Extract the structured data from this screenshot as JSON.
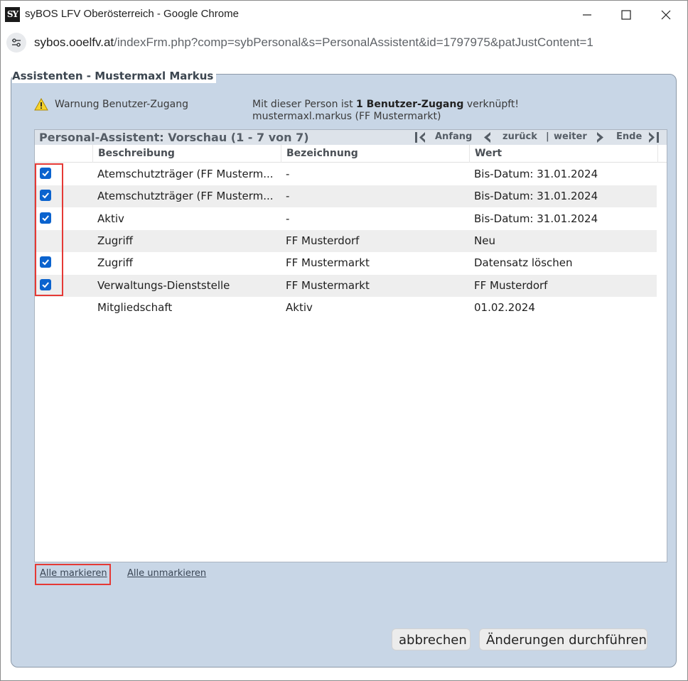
{
  "window": {
    "logo": "SY",
    "title": "syBOS LFV Oberösterreich - Google Chrome"
  },
  "address": {
    "host": "sybos.ooelfv.at",
    "path": "/indexFrm.php?comp=sybPersonal&s=PersonalAssistent&id=1797975&patJustContent=1"
  },
  "panel": {
    "title": "Assistenten - Mustermaxl Markus"
  },
  "warning": {
    "label": "Warnung Benutzer-Zugang",
    "line1_pre": "Mit dieser Person ist ",
    "line1_bold": "1 Benutzer-Zugang",
    "line1_post": " verknüpft!",
    "line2": "mustermaxl.markus (FF Mustermarkt)"
  },
  "grid": {
    "title": "Personal-Assistent: Vorschau (1 - 7 von 7)",
    "pager": {
      "first": "Anfang",
      "prev": "zurück",
      "separator": "|",
      "next": "weiter",
      "last": "Ende"
    },
    "columns": [
      "Beschreibung",
      "Bezeichnung",
      "Wert"
    ],
    "rows": [
      {
        "checked": true,
        "beschreibung": "Atemschutzträger (FF Musterm...",
        "bezeichnung": "-",
        "wert": "Bis-Datum: 31.01.2024"
      },
      {
        "checked": true,
        "beschreibung": "Atemschutzträger (FF Musterm...",
        "bezeichnung": "-",
        "wert": "Bis-Datum: 31.01.2024"
      },
      {
        "checked": true,
        "beschreibung": "Aktiv",
        "bezeichnung": "-",
        "wert": "Bis-Datum: 31.01.2024"
      },
      {
        "checked": false,
        "beschreibung": "Zugriff",
        "bezeichnung": "FF Musterdorf",
        "wert": "Neu"
      },
      {
        "checked": true,
        "beschreibung": "Zugriff",
        "bezeichnung": "FF Mustermarkt",
        "wert": "Datensatz löschen"
      },
      {
        "checked": true,
        "beschreibung": "Verwaltungs-Dienststelle",
        "bezeichnung": "FF Mustermarkt",
        "wert": "FF Musterdorf"
      },
      {
        "checked": false,
        "beschreibung": "Mitgliedschaft",
        "bezeichnung": "Aktiv",
        "wert": "01.02.2024"
      }
    ]
  },
  "links": {
    "mark_all": "Alle markieren",
    "unmark_all": "Alle unmarkieren"
  },
  "buttons": {
    "cancel": "abbrechen",
    "apply": "Änderungen durchführen"
  },
  "colors": {
    "panel_bg": "#c8d6e6",
    "checkbox": "#0b63ce",
    "highlight": "#e53935"
  }
}
